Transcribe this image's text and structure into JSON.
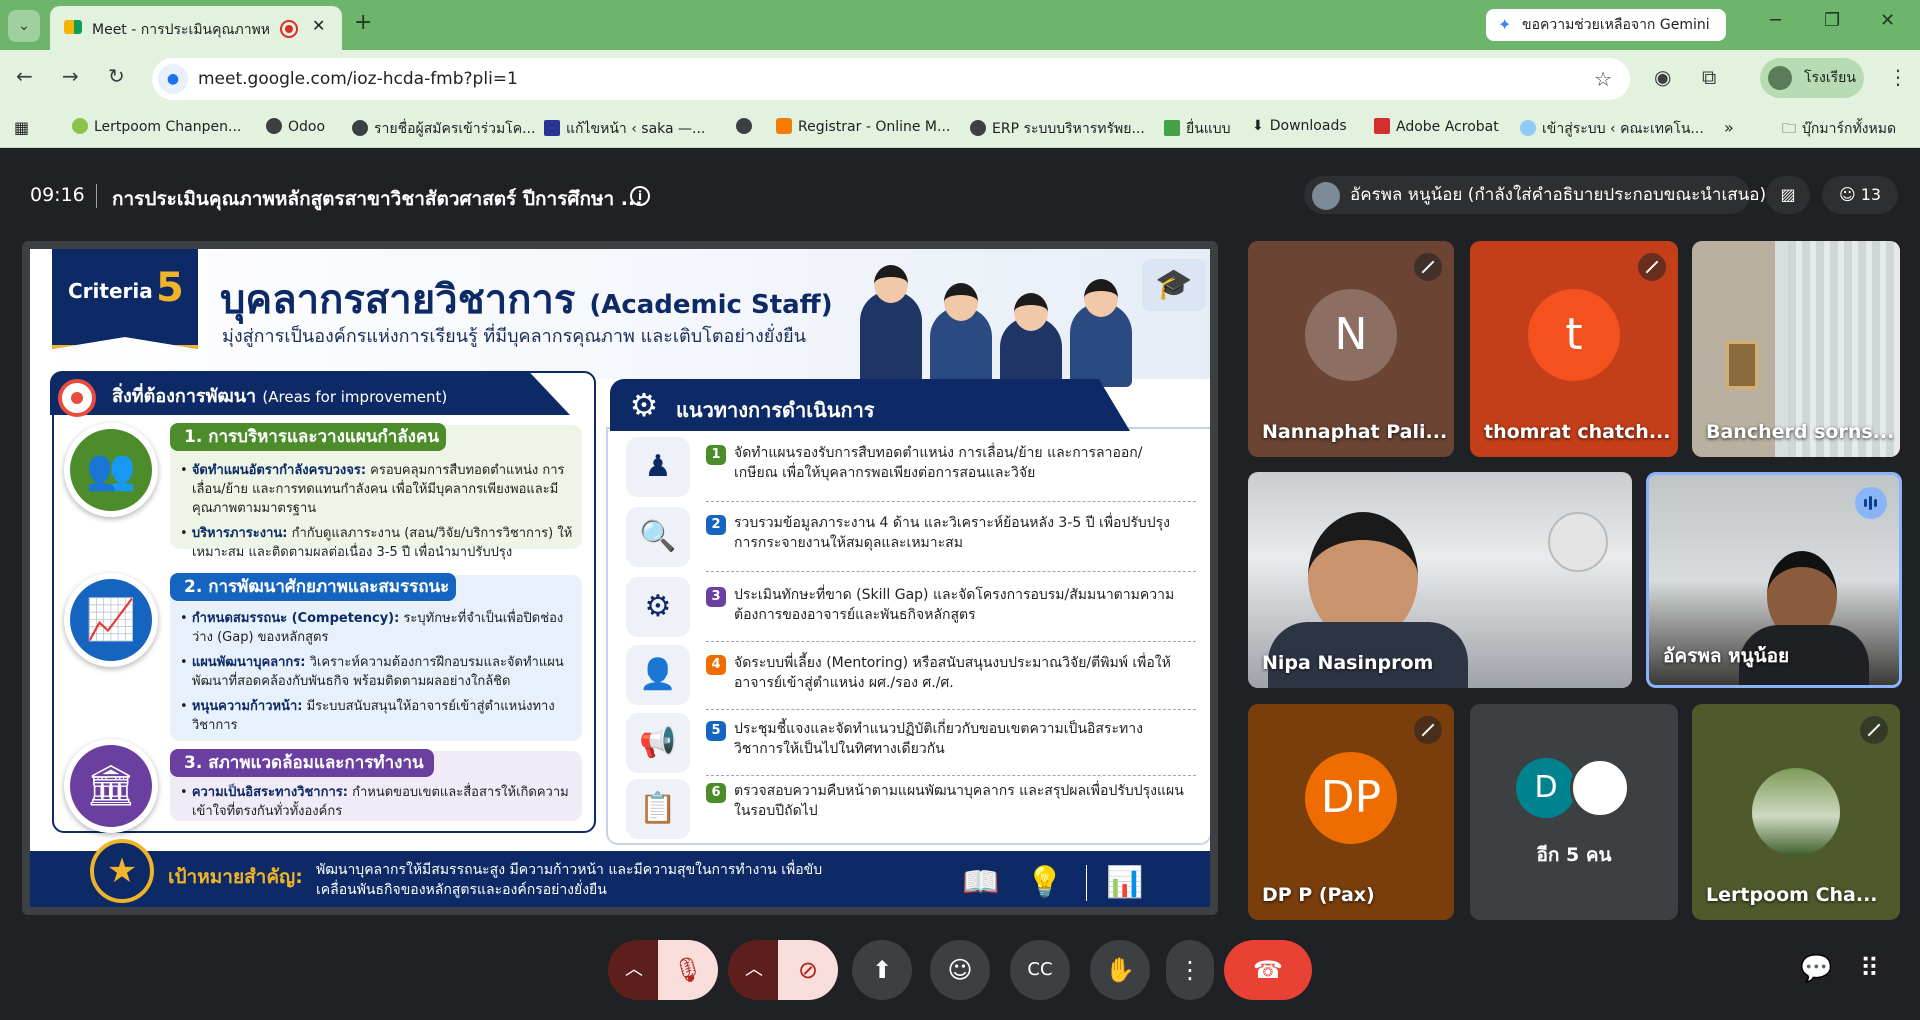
{
  "browser": {
    "tab_title": "Meet - การประเมินคุณภาพหลั",
    "new_tab": "+",
    "tab_close": "✕",
    "gemini_button": "ขอความช่วยเหลือจาก Gemini",
    "url": "meet.google.com/ioz-hcda-fmb?pli=1",
    "profile_label": "โรงเรียน",
    "bookmarks": [
      "Lertpoom Chanpen...",
      "Odoo",
      "รายชื่อผู้สมัครเข้าร่วมโค...",
      "แก้ไขหน้า ‹ saka —...",
      "",
      "Registrar - Online M...",
      "ERP ระบบบริหารทรัพย...",
      "ยื่นแบบ",
      "Downloads",
      "Adobe Acrobat",
      "เข้าสู่ระบบ ‹ คณะเทคโน..."
    ],
    "bookmarks_overflow": "»",
    "all_bookmarks": "บุ๊กมาร์กทั้งหมด"
  },
  "meet": {
    "time": "09:16",
    "title": "การประเมินคุณภาพหลักสูตรสาขาวิชาสัตวศาสตร์ ปีการศึกษา ...",
    "presenter": "อัครพล หนูน้อย (กำลังใส่คำอธิบายประกอบขณะนำเสนอ)",
    "participant_count": "13"
  },
  "slide": {
    "criteria_label": "Criteria",
    "criteria_number": "5",
    "title": "บุคลากรสายวิชาการ",
    "title_en": "(Academic Staff)",
    "subtitle": "มุ่งสู่การเป็นองค์กรแห่งการเรียนรู้ ที่มีบุคลากรคุณภาพ และเติบโตอย่างยั่งยืน",
    "left_heading": "สิ่งที่ต้องการพัฒนา",
    "left_heading_en": "(Areas for improvement)",
    "sections": [
      {
        "title": "1. การบริหารและวางแผนกำลังคน",
        "items": [
          {
            "label": "จัดทำแผนอัตรากำลังครบวงจร:",
            "text": "ครอบคลุมการสืบทอดตำแหน่ง การเลื่อน/ย้าย และการทดแทนกำลังคน เพื่อให้มีบุคลากรเพียงพอและมีคุณภาพตามมาตรฐาน"
          },
          {
            "label": "บริหารภาระงาน:",
            "text": "กำกับดูแลภาระงาน (สอน/วิจัย/บริการวิชาการ) ให้เหมาะสม และติดตามผลต่อเนื่อง 3-5 ปี เพื่อนำมาปรับปรุง"
          }
        ]
      },
      {
        "title": "2. การพัฒนาศักยภาพและสมรรถนะ",
        "items": [
          {
            "label": "กำหนดสมรรถนะ (Competency):",
            "text": "ระบุทักษะที่จำเป็นเพื่อปิดช่องว่าง (Gap) ของหลักสูตร"
          },
          {
            "label": "แผนพัฒนาบุคลากร:",
            "text": "วิเคราะห์ความต้องการฝึกอบรมและจัดทำแผนพัฒนาที่สอดคล้องกับพันธกิจ พร้อมติดตามผลอย่างใกล้ชิด"
          },
          {
            "label": "หนุนความก้าวหน้า:",
            "text": "มีระบบสนับสนุนให้อาจารย์เข้าสู่ตำแหน่งทางวิชาการ"
          }
        ]
      },
      {
        "title": "3. สภาพแวดล้อมและการทำงาน",
        "items": [
          {
            "label": "ความเป็นอิสระทางวิชาการ:",
            "text": "กำหนดขอบเขตและสื่อสารให้เกิดความเข้าใจที่ตรงกันทั่วทั้งองค์กร"
          }
        ]
      }
    ],
    "right_heading": "แนวทางการดำเนินการ",
    "steps": [
      {
        "num": "1",
        "text": "จัดทำแผนรองรับการสืบทอดตำแหน่ง การเลื่อน/ย้าย และการลาออก/เกษียณ เพื่อให้บุคลากรพอเพียงต่อการสอนและวิจัย"
      },
      {
        "num": "2",
        "text": "รวบรวมข้อมูลภาระงาน 4 ด้าน และวิเคราะห์ย้อนหลัง 3-5 ปี เพื่อปรับปรุงการกระจายงานให้สมดุลและเหมาะสม"
      },
      {
        "num": "3",
        "text": "ประเมินทักษะที่ขาด (Skill Gap) และจัดโครงการอบรม/สัมมนาตามความต้องการของอาจารย์และพันธกิจหลักสูตร"
      },
      {
        "num": "4",
        "text": "จัดระบบพี่เลี้ยง (Mentoring) หรือสนับสนุนงบประมาณวิจัย/ตีพิมพ์ เพื่อให้อาจารย์เข้าสู่ตำแหน่ง ผศ./รอง ศ./ศ."
      },
      {
        "num": "5",
        "text": "ประชุมชี้แจงและจัดทำแนวปฏิบัติเกี่ยวกับขอบเขตความเป็นอิสระทางวิชาการให้เป็นไปในทิศทางเดียวกัน"
      },
      {
        "num": "6",
        "text": "ตรวจสอบความคืบหน้าตามแผนพัฒนาบุคลากร และสรุปผลเพื่อปรับปรุงแผนในรอบปีถัดไป"
      }
    ],
    "goal_label": "เป้าหมายสำคัญ:",
    "goal_text": "พัฒนาบุคลากรให้มีสมรรถนะสูง มีความก้าวหน้า และมีความสุขในการทำงาน เพื่อขับเคลื่อนพันธกิจของหลักสูตรและองค์กรอย่างยั่งยืน"
  },
  "participants": [
    {
      "name": "Nannaphat Pali...",
      "initial": "N",
      "color": "#6d4c41"
    },
    {
      "name": "thomrat chatch...",
      "initial": "t",
      "color": "#f4511e"
    },
    {
      "name": "Bancherd sorns..."
    },
    {
      "name": "Nipa Nasinprom"
    },
    {
      "name": "อัครพล หนูน้อย"
    },
    {
      "name": "DP P (Pax)",
      "initial": "DP",
      "color": "#ef6c00"
    },
    {
      "name": "อีก 5 คน",
      "initial": "D",
      "color": "#00838f"
    },
    {
      "name": "Lertpoom Cha..."
    }
  ],
  "colors": {
    "chrome_green": "#6db56b",
    "navy": "#0d2a66",
    "gold": "#f0b429",
    "end_call": "#e94235"
  }
}
